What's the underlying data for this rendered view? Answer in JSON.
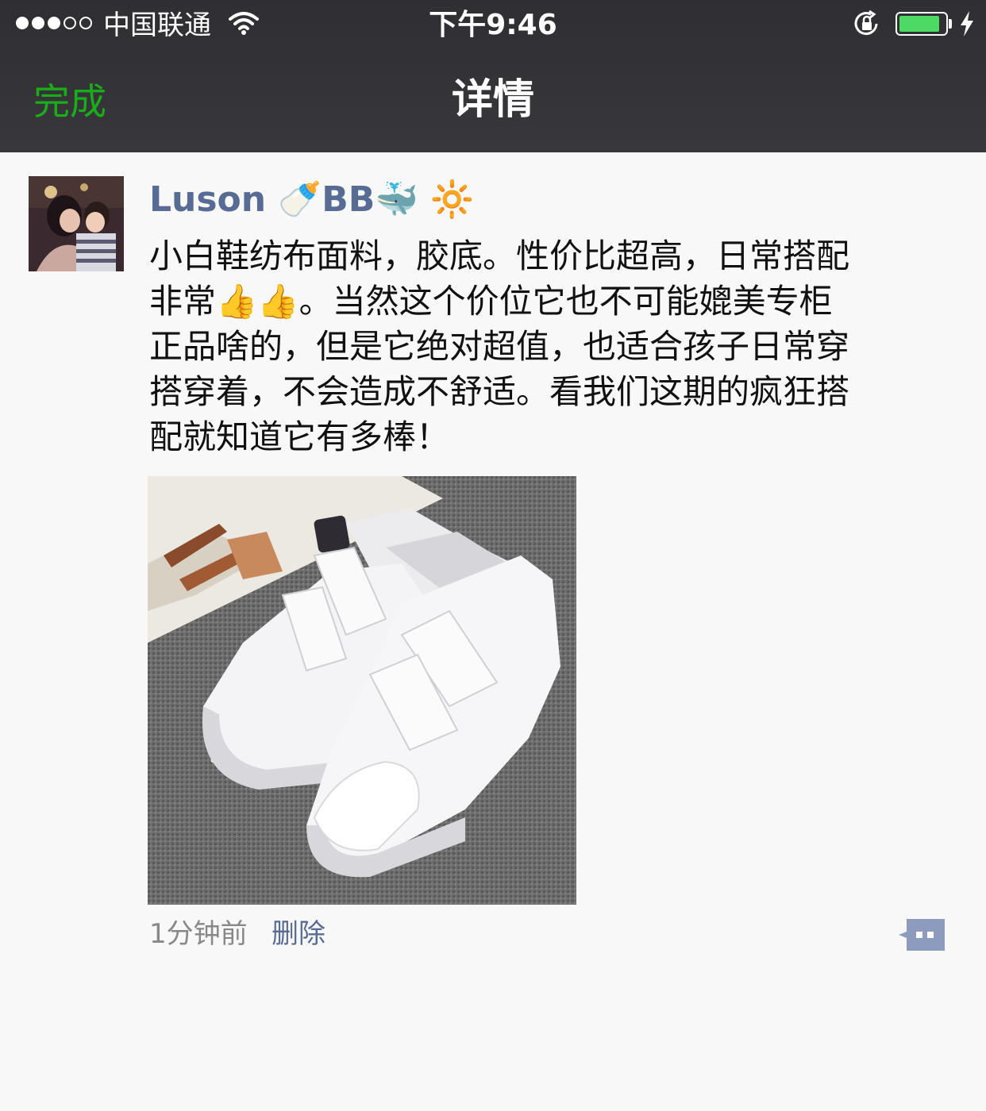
{
  "status_bar": {
    "carrier": "中国联通",
    "time": "下午9:46",
    "battery_level": 0.9
  },
  "navbar": {
    "back_label": "完成",
    "title": "详情"
  },
  "post": {
    "author": "Luson 🍼BB🐳 🔆",
    "content_lines": [
      "小白鞋纺布面料，胶底。性价比超高，日常搭配",
      "非常👍👍。当然这个价位它也不可能媲美专柜",
      "正品啥的，但是它绝对超值，也适合孩子日常穿",
      "搭穿着，不会造成不舒适。看我们这期的疯狂搭",
      "配就知道它有多棒！"
    ],
    "timestamp": "1分钟前",
    "delete_label": "删除"
  },
  "colors": {
    "accent_green": "#1aad19",
    "link_blue": "#576b95",
    "bar_dark": "#35353a"
  },
  "icons": [
    "signal-icon",
    "wifi-icon",
    "rotation-lock-icon",
    "battery-icon",
    "charging-bolt-icon",
    "comment-icon"
  ]
}
